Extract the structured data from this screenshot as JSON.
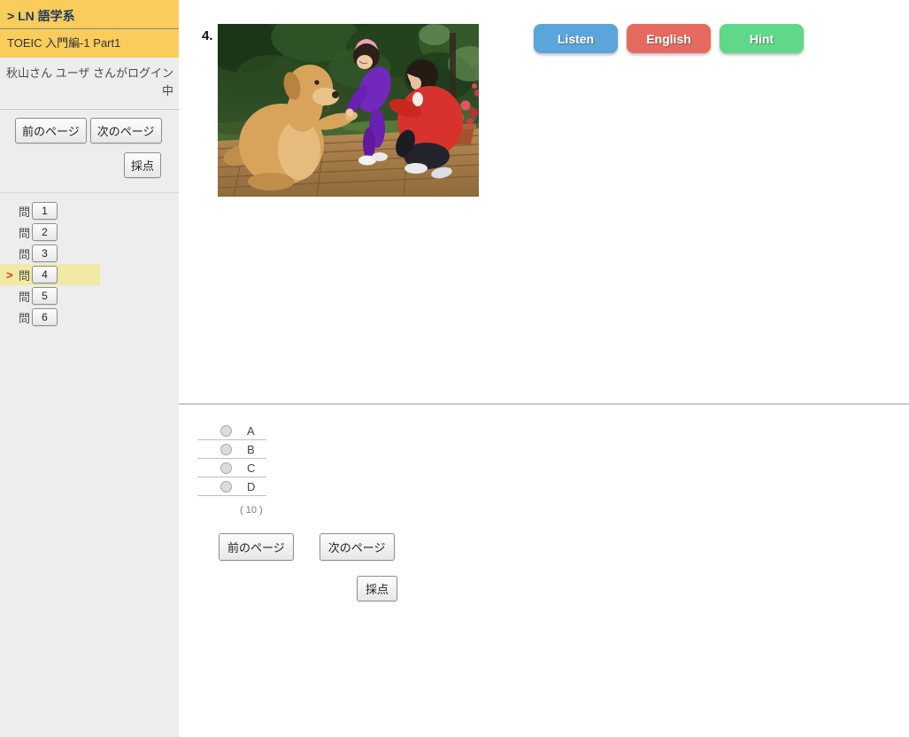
{
  "sidebar": {
    "course_title": "> LN 語学系",
    "course_subtitle": "TOEIC 入門編-1 Part1",
    "login_status": "秋山さん ユーザ さんがログイン中",
    "prev_button": "前のページ",
    "next_button": "次のページ",
    "score_button": "採点",
    "question_label": "問",
    "current_marker": ">",
    "current_question": "4",
    "questions": [
      "1",
      "2",
      "3",
      "4",
      "5",
      "6"
    ]
  },
  "main": {
    "question_number": "4.",
    "image_alt": "Photo: a golden retriever dog giving its paw to two girls, one in a purple jacket with a pink headband and one in a red jacket, crouching on a wooden deck with trees and red flowers behind",
    "buttons": {
      "listen": "Listen",
      "english": "English",
      "hint": "Hint"
    },
    "colors": {
      "listen": "#5AA5DA",
      "english": "#E46A5F",
      "hint": "#5FD88A"
    },
    "answers": {
      "options": [
        "A",
        "B",
        "C",
        "D"
      ],
      "points": "( 10 )"
    },
    "prev_button": "前のページ",
    "next_button": "次のページ",
    "score_button": "採点"
  }
}
